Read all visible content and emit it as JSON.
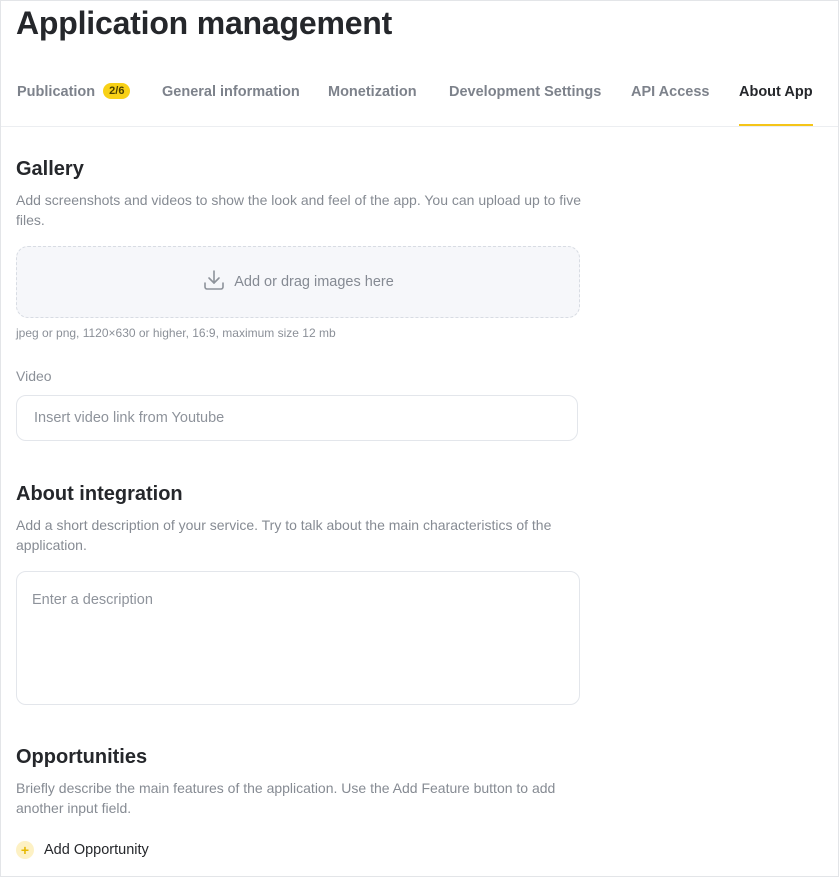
{
  "page": {
    "title": "Application management"
  },
  "tabs": [
    {
      "label": "Publication",
      "badge": "2/6"
    },
    {
      "label": "General information"
    },
    {
      "label": "Monetization"
    },
    {
      "label": "Development Settings"
    },
    {
      "label": "API Access"
    },
    {
      "label": "About App",
      "active": true
    }
  ],
  "gallery": {
    "title": "Gallery",
    "description": "Add screenshots and videos to show the look and feel of the app. You can upload up to five files.",
    "dropzone_text": "Add or drag images here",
    "dropzone_icon": "download-icon",
    "hint": "jpeg or png, 1120×630 or higher, 16:9, maximum size 12 mb",
    "video_label": "Video",
    "video_placeholder": "Insert video link from Youtube",
    "video_value": ""
  },
  "integration": {
    "title": "About integration",
    "description": "Add a short description of your service. Try to talk about the main characteristics of the application.",
    "placeholder": "Enter a description",
    "value": ""
  },
  "opportunities": {
    "title": "Opportunities",
    "description": "Briefly describe the main features of the application. Use the Add Feature button to add another input field.",
    "add_label": "Add Opportunity",
    "add_icon": "plus-icon"
  },
  "colors": {
    "accent": "#f5c518",
    "badge": "#f8d117",
    "text_primary": "#25272b",
    "text_muted": "#868b93"
  }
}
